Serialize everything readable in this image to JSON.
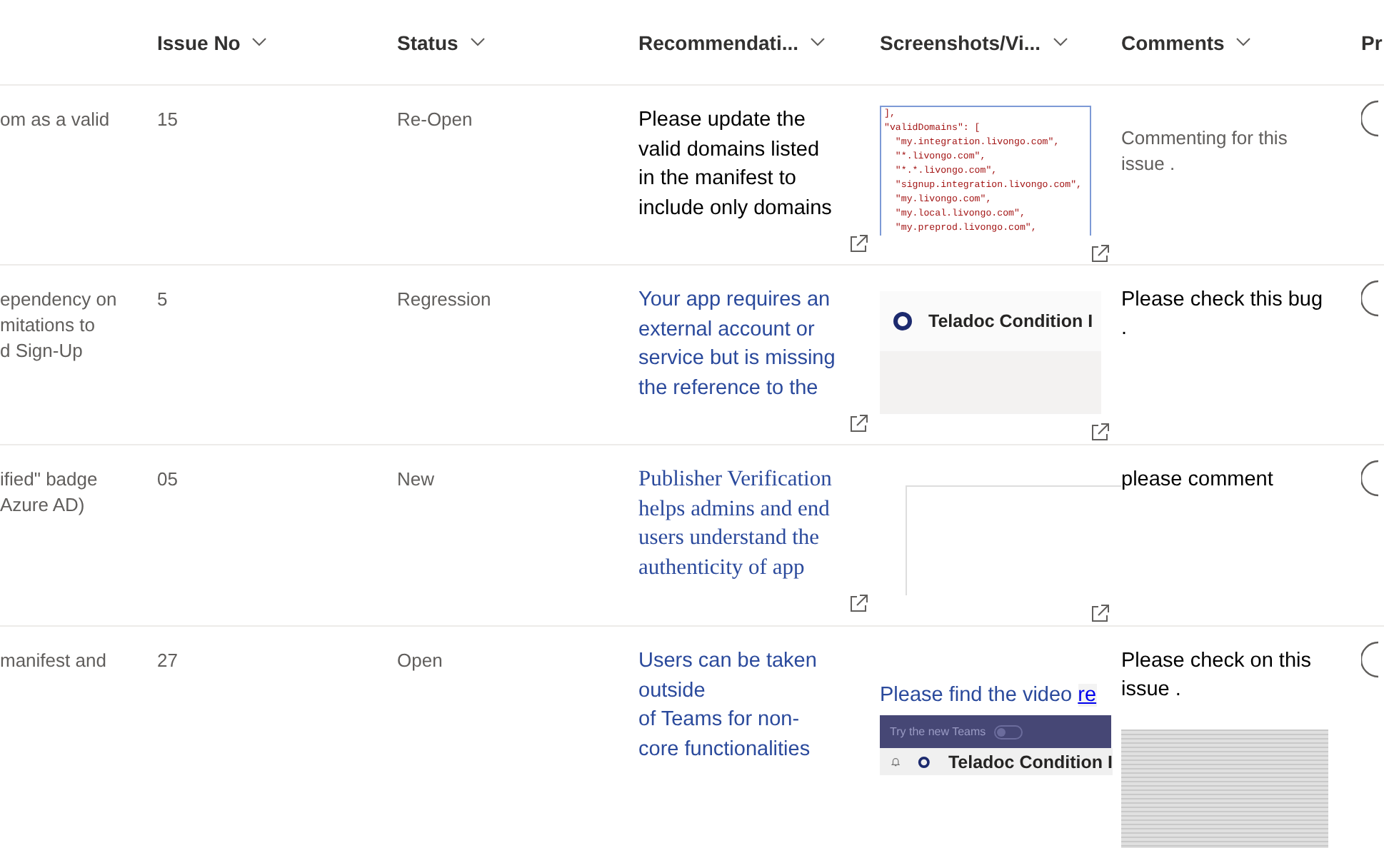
{
  "columns": [
    {
      "label": "Issue No",
      "sortable": true
    },
    {
      "label": "Status",
      "sortable": true
    },
    {
      "label": "Recommendati...",
      "sortable": true
    },
    {
      "label": "Screenshots/Vi...",
      "sortable": true
    },
    {
      "label": "Comments",
      "sortable": true
    },
    {
      "label": "Pr",
      "sortable": false
    }
  ],
  "rows": [
    {
      "column_1": [
        "om as a valid"
      ],
      "issue_no": "15",
      "status": "Re-Open",
      "recommendation": {
        "lines": [
          "Please update the",
          "valid domains listed",
          "in the manifest to",
          "include only domains"
        ]
      },
      "screenshot": {
        "kind": "code",
        "lines": [
          "],",
          "\"validDomains\": [",
          "  \"my.integration.livongo.com\",",
          "  \"*.livongo.com\",",
          "  \"*.*.livongo.com\",",
          "  \"signup.integration.livongo.com\",",
          "  \"my.livongo.com\",",
          "  \"my.local.livongo.com\",",
          "  \"my.preprod.livongo.com\","
        ]
      },
      "comment": {
        "lines": [
          "Commenting for this",
          "issue ."
        ]
      }
    },
    {
      "column_1": [
        "ependency on",
        "mitations to",
        "d Sign-Up"
      ],
      "issue_no": "5",
      "status": "Regression",
      "recommendation": {
        "lines": [
          "Your app requires an",
          "external account or",
          "service but is missing",
          "the reference to the"
        ]
      },
      "screenshot": {
        "kind": "app",
        "title": "Teladoc Condition I"
      },
      "comment": {
        "lines": [
          "Please check this bug",
          "."
        ]
      }
    },
    {
      "column_1": [
        "ified\" badge",
        "Azure AD)"
      ],
      "issue_no": "05",
      "status": "New",
      "recommendation": {
        "lines": [
          "Publisher Verification",
          "helps admins and end",
          "users understand the",
          "authenticity of app"
        ]
      },
      "screenshot": {
        "kind": "blank"
      },
      "comment": {
        "lines": [
          "please comment"
        ]
      }
    },
    {
      "column_1": [
        "manifest and"
      ],
      "issue_no": "27",
      "status": "Open",
      "recommendation": {
        "lines": [
          "Users can be taken",
          "outside",
          "of Teams for non-",
          "core functionalities"
        ]
      },
      "screenshot": {
        "kind": "video",
        "text": "Please find the video ",
        "link": "re",
        "banner": "Try the new Teams",
        "title": "Teladoc Condition I"
      },
      "comment": {
        "lines": [
          "Please check on this",
          "issue ."
        ],
        "attachment": true
      }
    }
  ]
}
